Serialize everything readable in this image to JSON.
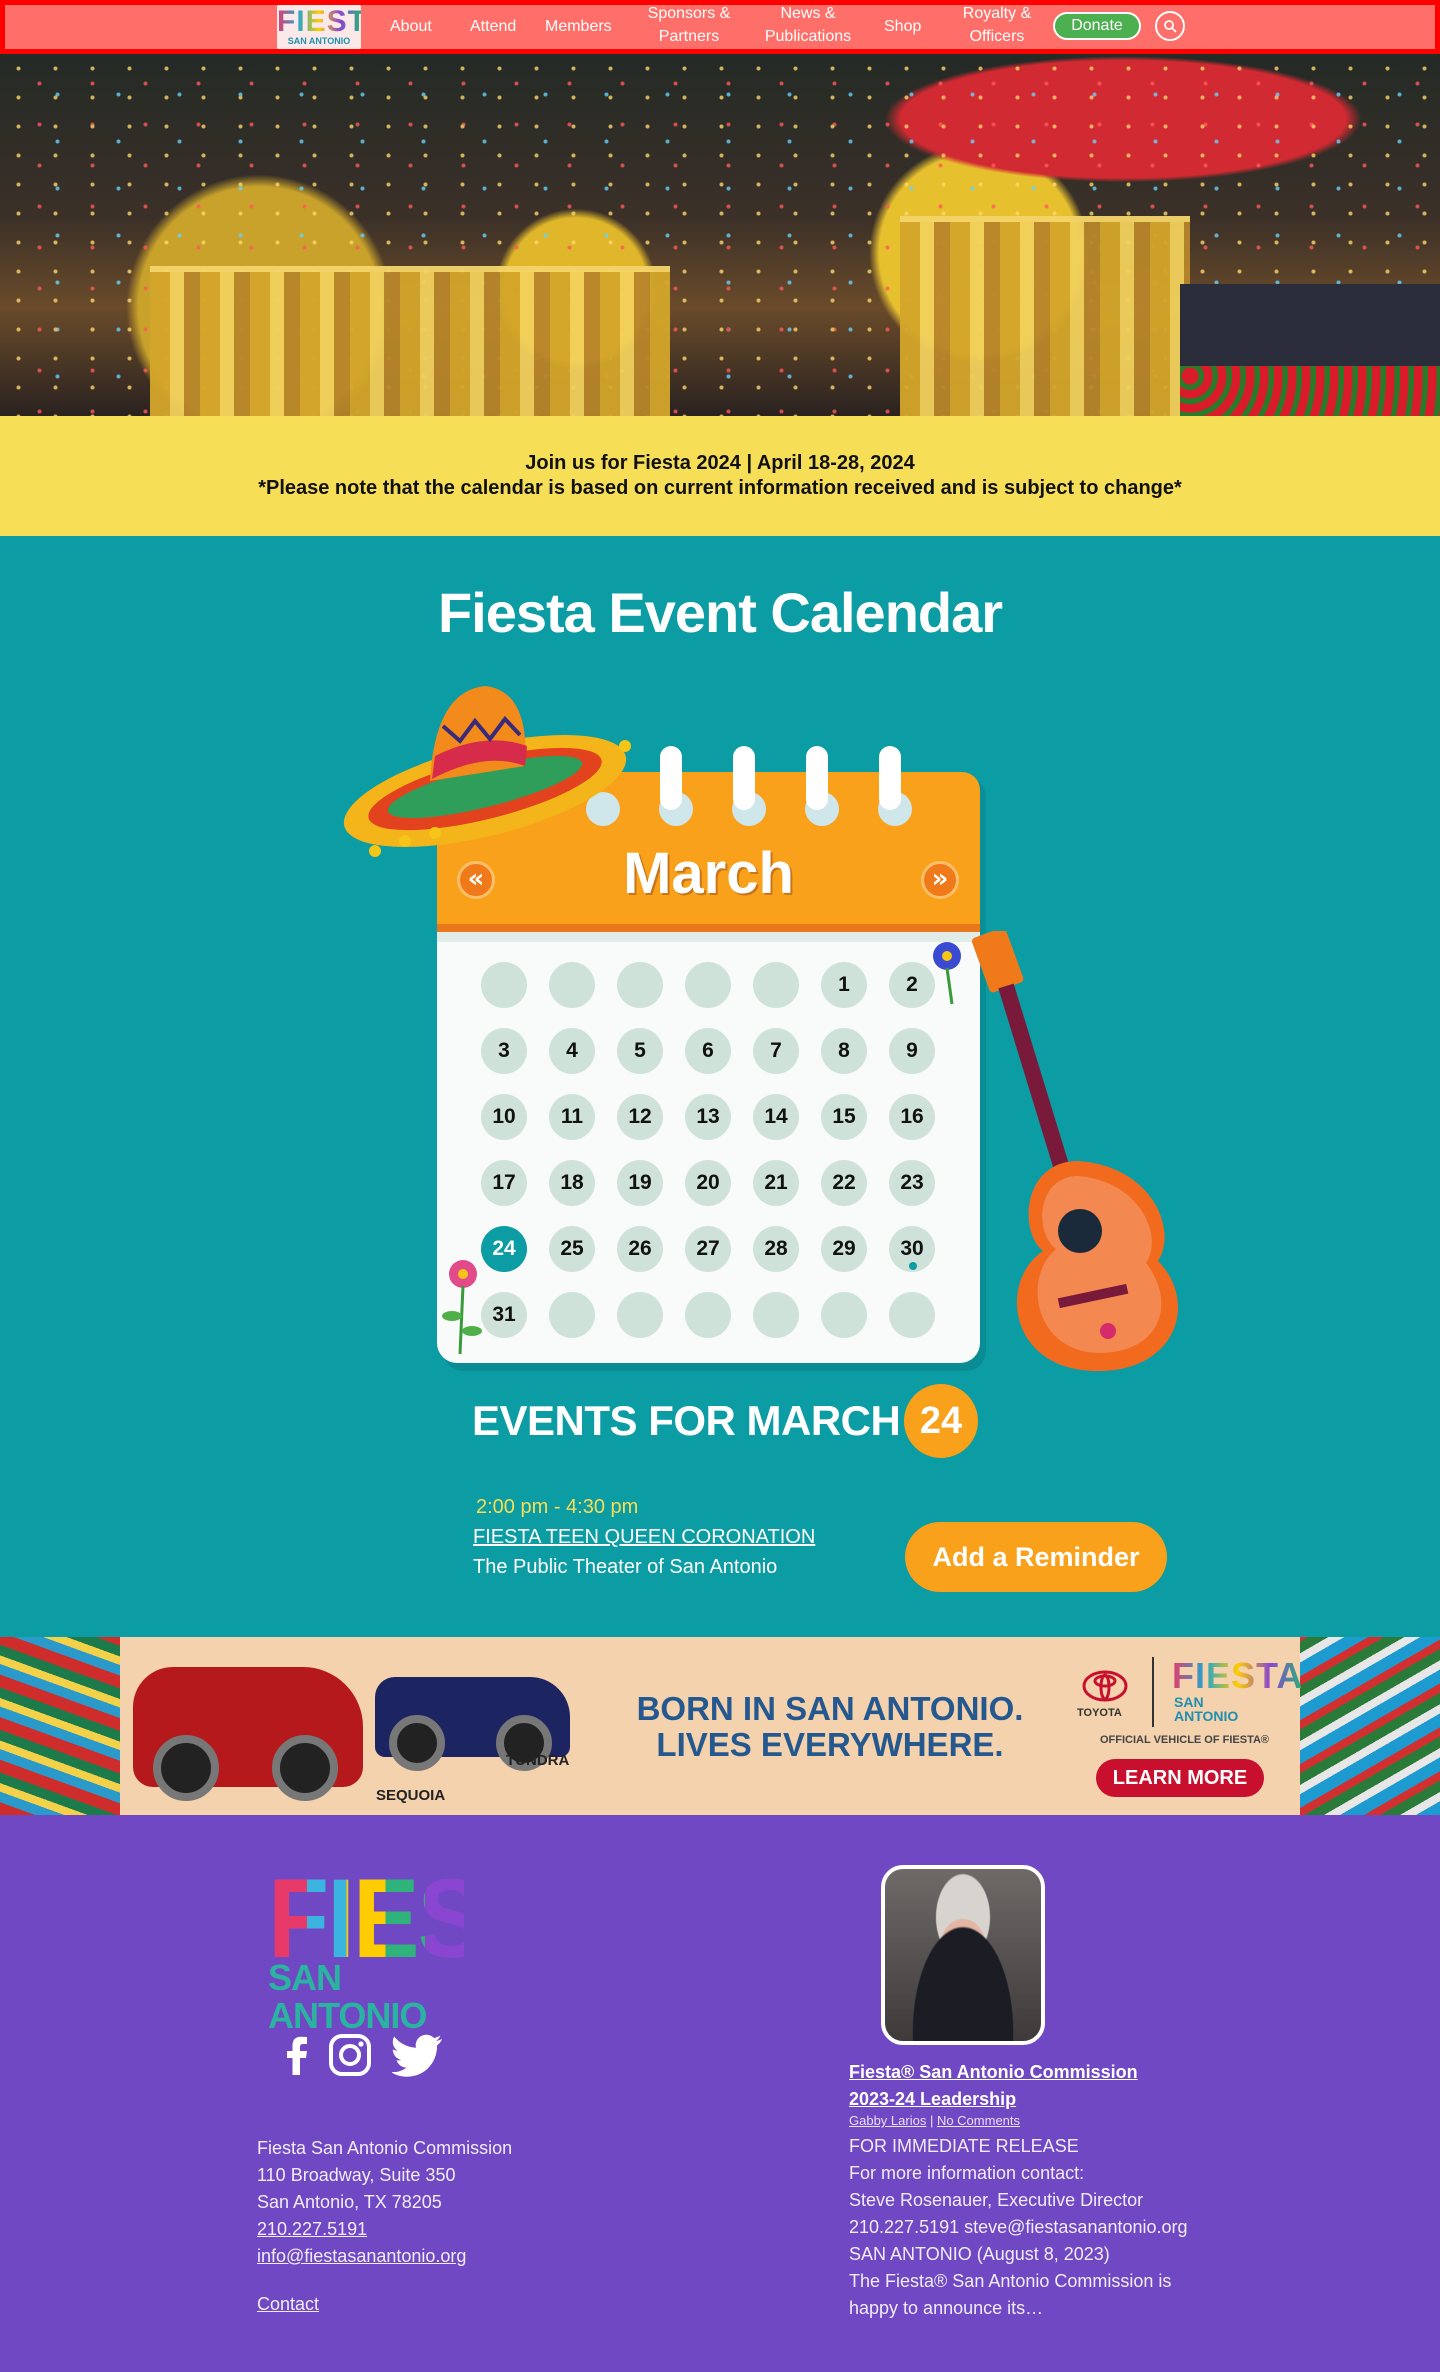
{
  "nav": {
    "logo_word": "FIESTA",
    "logo_sub": "SAN ANTONIO",
    "items": [
      {
        "label_1": "About",
        "label_2": ""
      },
      {
        "label_1": "Attend",
        "label_2": ""
      },
      {
        "label_1": "Members",
        "label_2": ""
      },
      {
        "label_1": "Sponsors &",
        "label_2": "Partners"
      },
      {
        "label_1": "News &",
        "label_2": "Publications"
      },
      {
        "label_1": "Shop",
        "label_2": ""
      },
      {
        "label_1": "Royalty &",
        "label_2": "Officers"
      }
    ],
    "donate_label": "Donate",
    "search_icon": "search-icon"
  },
  "notice": {
    "line1": "Join us for Fiesta 2024 | April 18-28, 2024",
    "line2": "*Please note that the calendar is based on current information received and is subject to change*"
  },
  "calendar": {
    "title": "Fiesta Event Calendar",
    "month": "March",
    "prev_icon": "chevron-double-left-icon",
    "next_icon": "chevron-double-right-icon",
    "days": [
      "",
      "",
      "",
      "",
      "",
      "1",
      "2",
      "3",
      "4",
      "5",
      "6",
      "7",
      "8",
      "9",
      "10",
      "11",
      "12",
      "13",
      "14",
      "15",
      "16",
      "17",
      "18",
      "19",
      "20",
      "21",
      "22",
      "23",
      "24",
      "25",
      "26",
      "27",
      "28",
      "29",
      "30",
      "31",
      "",
      "",
      "",
      "",
      "",
      ""
    ],
    "selected_day": "24",
    "event_dot_day": "30"
  },
  "events": {
    "heading": "EVENTS FOR MARCH",
    "day": "24",
    "items": [
      {
        "time": "2:00 pm - 4:30 pm",
        "name": "FIESTA TEEN QUEEN CORONATION",
        "venue": "The Public Theater of San Antonio"
      }
    ],
    "reminder_label": "Add a Reminder"
  },
  "ad": {
    "headline_1": "BORN IN SAN ANTONIO.",
    "headline_2": "LIVES EVERYWHERE.",
    "car_1": "SEQUOIA",
    "car_2": "TUNDRA",
    "toyota": "TOYOTA",
    "fiesta": "FIESTA",
    "fiesta_sub": "SAN ANTONIO",
    "official": "OFFICIAL VEHICLE OF FIESTA®",
    "cta": "LEARN MORE"
  },
  "footer": {
    "logo_word": "FIESTA",
    "logo_sub": "SAN ANTONIO",
    "address": [
      "Fiesta San Antonio Commission",
      "110 Broadway, Suite 350",
      "San Antonio, TX 78205"
    ],
    "phone": "210.227.5191",
    "email": "info@fiestasanantonio.org",
    "contact": "Contact",
    "news": {
      "title_1": "Fiesta® San Antonio Commission",
      "title_2": "2023-24 Leadership",
      "author": "Gabby Larios",
      "sep": " | ",
      "comments": "No Comments",
      "body": [
        "FOR IMMEDIATE RELEASE",
        "For more information contact:",
        "Steve Rosenauer, Executive Director",
        "210.227.5191 steve@fiestasanantonio.org",
        "SAN ANTONIO (August 8, 2023)",
        "The Fiesta® San Antonio Commission is",
        "happy to announce its…"
      ]
    }
  }
}
